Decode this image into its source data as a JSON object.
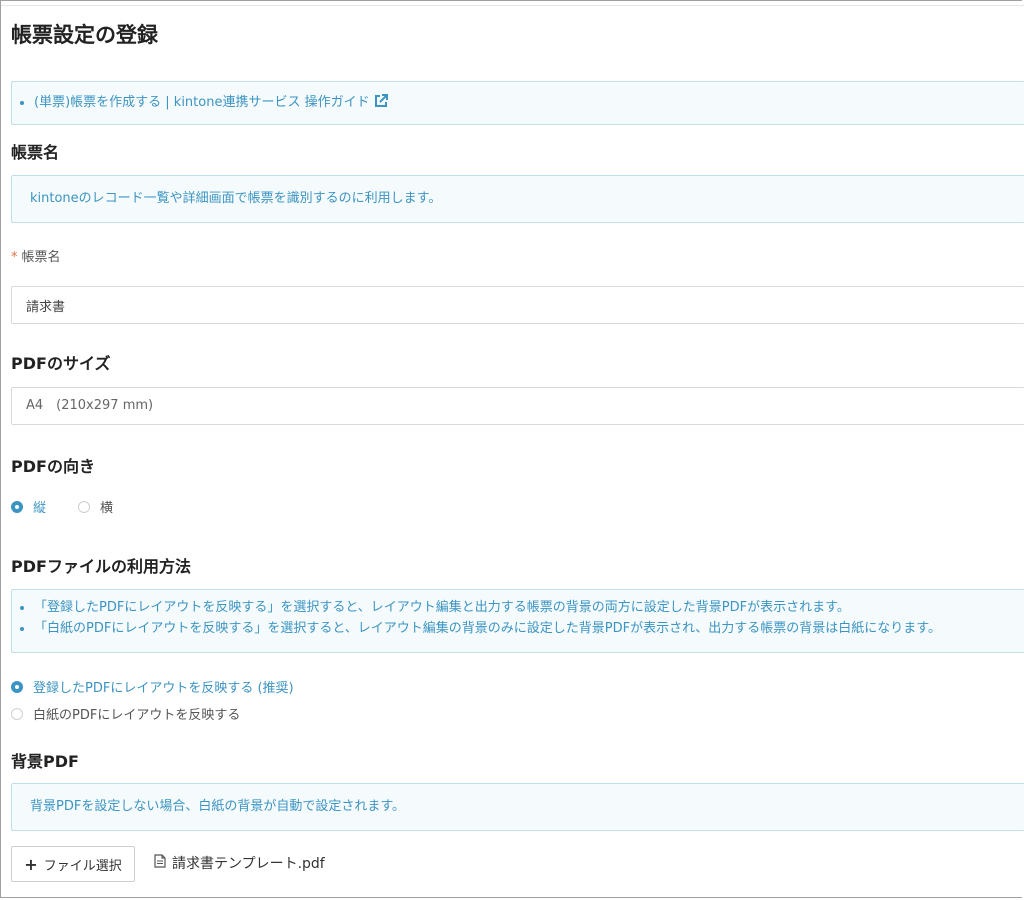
{
  "page": {
    "title": "帳票設定の登録"
  },
  "guide": {
    "link_text": "(単票)帳票を作成する | kintone連携サービス 操作ガイド",
    "link_icon": "external-link-icon"
  },
  "report_name": {
    "section_title": "帳票名",
    "info": "kintoneのレコード一覧や詳細画面で帳票を識別するのに利用します。",
    "required_mark": "*",
    "field_label": "帳票名",
    "field_value": "請求書"
  },
  "pdf_size": {
    "section_title": "PDFのサイズ",
    "selected": "A4　(210x297 mm)"
  },
  "pdf_orientation": {
    "section_title": "PDFの向き",
    "options": [
      {
        "label": "縦",
        "checked": true
      },
      {
        "label": "横",
        "checked": false
      }
    ]
  },
  "pdf_usage": {
    "section_title": "PDFファイルの利用方法",
    "notes": [
      "「登録したPDFにレイアウトを反映する」を選択すると、レイアウト編集と出力する帳票の背景の両方に設定した背景PDFが表示されます。",
      "「白紙のPDFにレイアウトを反映する」を選択すると、レイアウト編集の背景のみに設定した背景PDFが表示され、出力する帳票の背景は白紙になります。"
    ],
    "options": [
      {
        "label": "登録したPDFにレイアウトを反映する (推奨)",
        "checked": true
      },
      {
        "label": "白紙のPDFにレイアウトを反映する",
        "checked": false
      }
    ]
  },
  "background_pdf": {
    "section_title": "背景PDF",
    "info": "背景PDFを設定しない場合、白紙の背景が自動で設定されます。",
    "button_label": "ファイル選択",
    "button_icon": "plus-icon",
    "file_icon": "document-icon",
    "file_name": "請求書テンプレート.pdf"
  },
  "colors": {
    "accent": "#3c94c2",
    "info_bg": "#f5fbfd",
    "info_border": "#bfe0ea",
    "required": "#e07040"
  }
}
